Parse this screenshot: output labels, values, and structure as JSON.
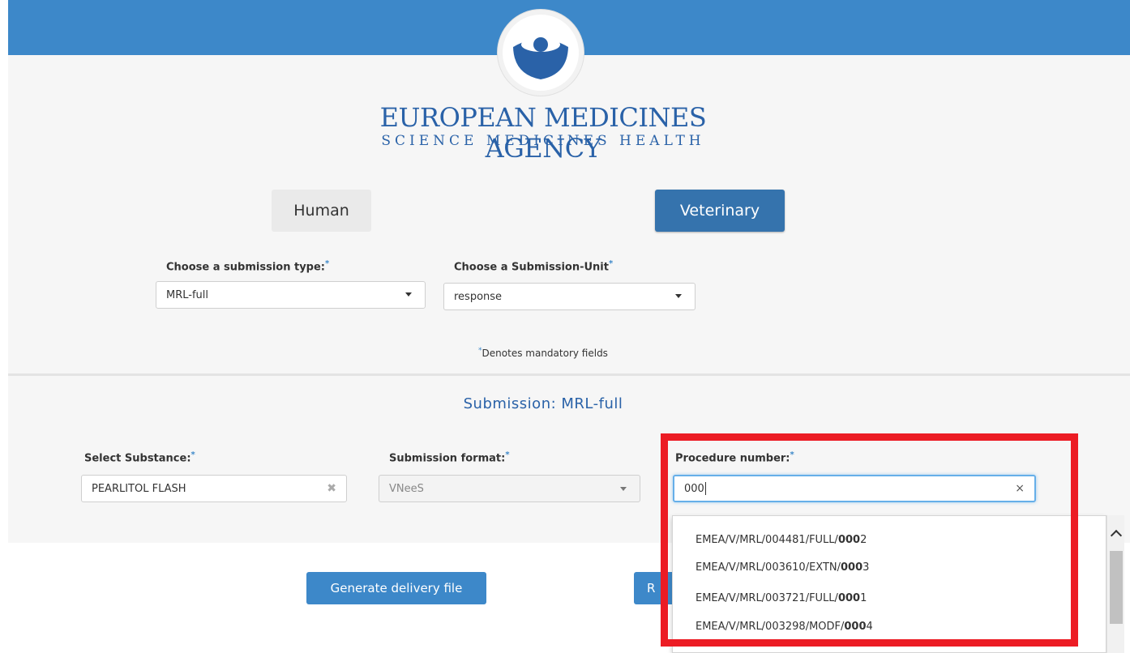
{
  "brand": {
    "name": "EUROPEAN MEDICINES AGENCY",
    "tagline": "SCIENCE   MEDICINES   HEALTH"
  },
  "domain_tabs": {
    "human": "Human",
    "veterinary": "Veterinary",
    "selected": "veterinary"
  },
  "submission_type": {
    "label": "Choose a submission type:",
    "required_mark": "*",
    "value": "MRL-full"
  },
  "submission_unit": {
    "label": "Choose a Submission-Unit",
    "required_mark": "*",
    "value": "response"
  },
  "mandatory_note": {
    "mark": "*",
    "text": "Denotes mandatory fields"
  },
  "section": {
    "title": "Submission: MRL-full"
  },
  "substance": {
    "label": "Select Substance:",
    "required_mark": "*",
    "value": "PEARLITOL FLASH",
    "clear": "✖"
  },
  "format": {
    "label": "Submission format:",
    "required_mark": "*",
    "value": "VNeeS"
  },
  "procedure": {
    "label": "Procedure number:",
    "required_mark": "*",
    "value": "000",
    "clear": "×",
    "suggestions": [
      {
        "prefix": "EMEA/V/MRL/004481/FULL/",
        "match": "000",
        "suffix": "2"
      },
      {
        "prefix": "EMEA/V/MRL/003610/EXTN/",
        "match": "000",
        "suffix": "3"
      },
      {
        "prefix": "EMEA/V/MRL/003721/FULL/",
        "match": "000",
        "suffix": "1"
      },
      {
        "prefix": "EMEA/V/MRL/003298/MODF/",
        "match": "000",
        "suffix": "4"
      }
    ]
  },
  "actions": {
    "generate": "Generate delivery file",
    "second_partial": "R"
  },
  "colors": {
    "header": "#3d88c9",
    "brand": "#2a62a8",
    "selected_tab": "#3573ad",
    "highlight": "#ec1c24"
  }
}
